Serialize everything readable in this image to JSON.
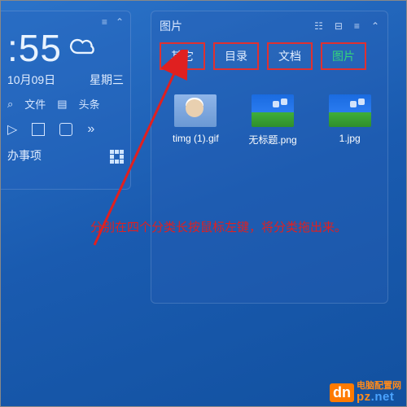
{
  "left_widget": {
    "menu_icon": "≡",
    "collapse_icon": "⌃",
    "time": ":55",
    "date": "10月09日",
    "weekday": "星期三",
    "search_icon": "⌕",
    "file_label": "文件",
    "doc_icon": "▤",
    "headlines_label": "头条",
    "chevrons": "»",
    "todo_label": "办事项"
  },
  "right_panel": {
    "title": "图片",
    "head_icons": {
      "list": "☷",
      "lock": "⊟",
      "menu": "≡",
      "collapse": "⌃"
    },
    "tabs": [
      {
        "label": "其它",
        "active": false
      },
      {
        "label": "目录",
        "active": false
      },
      {
        "label": "文档",
        "active": false
      },
      {
        "label": "图片",
        "active": true
      }
    ],
    "items": [
      {
        "caption": "timg (1).gif",
        "kind": "person"
      },
      {
        "caption": "无标题.png",
        "kind": "landscape"
      },
      {
        "caption": "1.jpg",
        "kind": "landscape"
      }
    ]
  },
  "annotation": {
    "text": "分别在四个分类长按鼠标左键，将分类拖出来。"
  },
  "watermark": {
    "badge": "dn",
    "cn": "电脑配置网",
    "en_prefix": "pz",
    "en_suffix": ".net"
  }
}
